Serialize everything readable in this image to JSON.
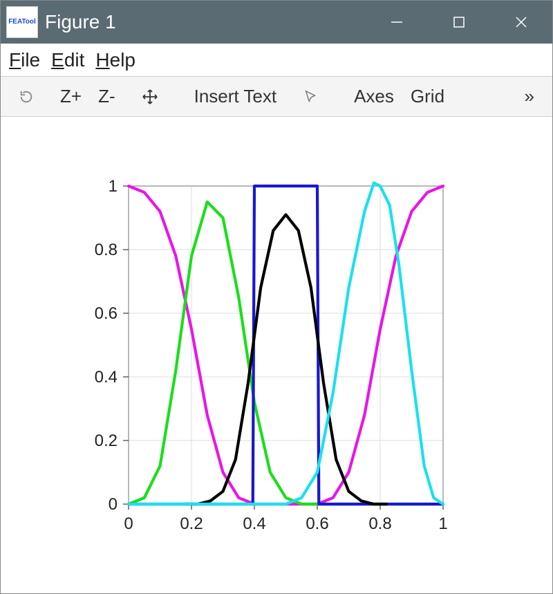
{
  "window": {
    "title": "Figure 1",
    "app_icon_text": "FEATool"
  },
  "menu": {
    "file": "File",
    "edit": "Edit",
    "help": "Help"
  },
  "toolbar": {
    "restore": "⟳",
    "zoom_in": "Z+",
    "zoom_out": "Z-",
    "pan": "✥",
    "insert_text": "Insert Text",
    "pointer": "↖",
    "axes": "Axes",
    "grid": "Grid",
    "overflow": "»"
  },
  "chart_data": {
    "type": "line",
    "xlabel": "",
    "ylabel": "",
    "xlim": [
      0,
      1
    ],
    "ylim": [
      0,
      1
    ],
    "xticks": [
      0,
      0.2,
      0.4,
      0.6,
      0.8,
      1
    ],
    "yticks": [
      0,
      0.2,
      0.4,
      0.6,
      0.8,
      1
    ],
    "grid": true,
    "series": [
      {
        "name": "magenta",
        "color": "#e815e8",
        "x": [
          0,
          0.05,
          0.1,
          0.15,
          0.2,
          0.25,
          0.3,
          0.35,
          0.4,
          0.45,
          0.5,
          0.55,
          0.6,
          0.65,
          0.7,
          0.75,
          0.8,
          0.85,
          0.9,
          0.95,
          1.0
        ],
        "y": [
          1.0,
          0.98,
          0.92,
          0.78,
          0.55,
          0.28,
          0.1,
          0.02,
          0.0,
          0.0,
          0.0,
          0.0,
          0.0,
          0.02,
          0.1,
          0.28,
          0.55,
          0.78,
          0.92,
          0.98,
          1.0
        ]
      },
      {
        "name": "green",
        "color": "#1bde1b",
        "x": [
          0,
          0.05,
          0.1,
          0.15,
          0.2,
          0.25,
          0.3,
          0.35,
          0.4,
          0.45,
          0.5,
          0.55,
          0.6,
          0.65,
          0.7,
          0.75,
          0.8,
          0.85,
          0.9,
          0.95,
          1.0
        ],
        "y": [
          0.0,
          0.02,
          0.12,
          0.42,
          0.78,
          0.95,
          0.9,
          0.65,
          0.32,
          0.1,
          0.02,
          0.0,
          0.0,
          0.0,
          0.0,
          0.0,
          0.0,
          0.0,
          0.0,
          0.0,
          0.0
        ]
      },
      {
        "name": "blue-step",
        "color": "#1818d0",
        "x": [
          0.0,
          0.395,
          0.4,
          0.6,
          0.605,
          1.0
        ],
        "y": [
          0.0,
          0.0,
          1.0,
          1.0,
          0.0,
          0.0
        ]
      },
      {
        "name": "black",
        "color": "#000000",
        "x": [
          0.18,
          0.22,
          0.26,
          0.3,
          0.34,
          0.38,
          0.42,
          0.46,
          0.5,
          0.54,
          0.58,
          0.62,
          0.66,
          0.7,
          0.74,
          0.78,
          0.82
        ],
        "y": [
          0.0,
          0.0,
          0.01,
          0.04,
          0.14,
          0.38,
          0.68,
          0.86,
          0.91,
          0.86,
          0.68,
          0.38,
          0.14,
          0.04,
          0.01,
          0.0,
          0.0
        ]
      },
      {
        "name": "cyan",
        "color": "#1ae0ef",
        "x": [
          0,
          0.05,
          0.1,
          0.15,
          0.2,
          0.25,
          0.3,
          0.35,
          0.4,
          0.45,
          0.5,
          0.55,
          0.6,
          0.65,
          0.7,
          0.75,
          0.78,
          0.8,
          0.83,
          0.86,
          0.9,
          0.94,
          0.97,
          1.0
        ],
        "y": [
          0.0,
          0.0,
          0.0,
          0.0,
          0.0,
          0.0,
          0.0,
          0.0,
          0.0,
          0.0,
          0.0,
          0.02,
          0.1,
          0.35,
          0.68,
          0.92,
          1.01,
          1.0,
          0.94,
          0.75,
          0.42,
          0.12,
          0.02,
          0.0
        ]
      }
    ]
  }
}
